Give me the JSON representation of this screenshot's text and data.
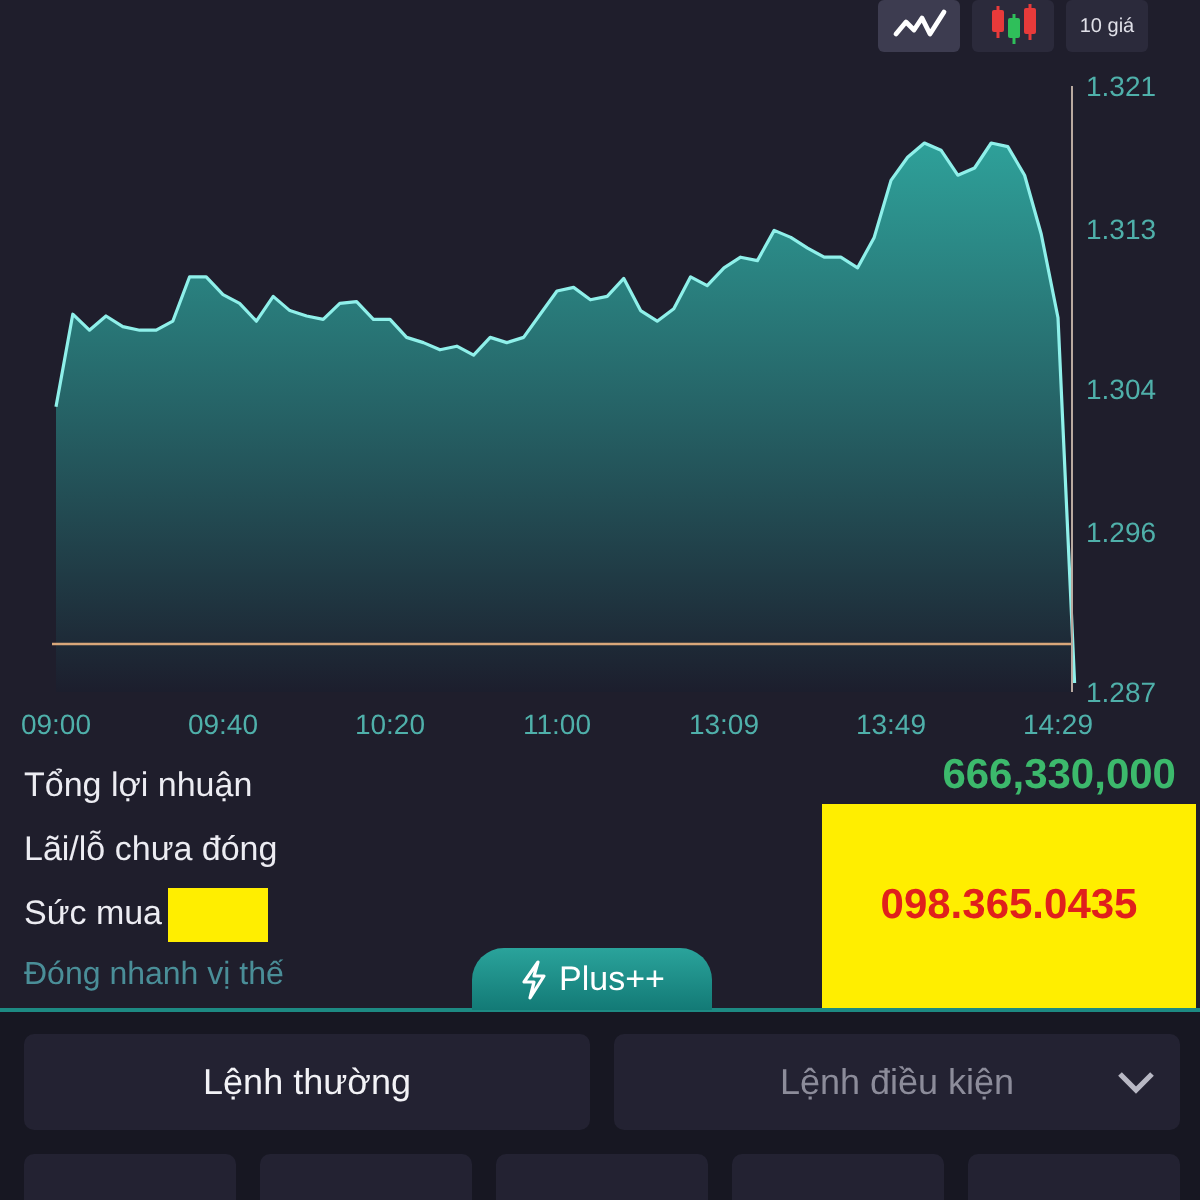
{
  "chart_toolbar": {
    "buttons": [
      {
        "kind": "line",
        "selected": true
      },
      {
        "kind": "candles",
        "selected": false
      },
      {
        "kind": "text",
        "label": "10 giá",
        "selected": false
      }
    ]
  },
  "price_chart": {
    "chart_data": {
      "type": "area",
      "categories": [
        "09:00",
        null,
        null,
        null,
        null,
        null,
        null,
        null,
        null,
        null,
        "09:40",
        null,
        null,
        null,
        null,
        null,
        null,
        null,
        null,
        null,
        "10:20",
        null,
        null,
        null,
        null,
        null,
        null,
        null,
        null,
        null,
        "11:00",
        null,
        null,
        null,
        null,
        null,
        null,
        null,
        null,
        null,
        "13:09",
        null,
        null,
        null,
        null,
        null,
        null,
        null,
        null,
        null,
        "13:49",
        null,
        null,
        null,
        null,
        null,
        null,
        null,
        null,
        null,
        "14:29",
        null
      ],
      "series": [
        {
          "color": "#8ff0ea",
          "values": [
            1.303,
            1.3082,
            1.3073,
            1.3081,
            1.3075,
            1.3073,
            1.3073,
            1.3078,
            1.3103,
            1.3103,
            1.3093,
            1.3088,
            1.3078,
            1.3092,
            1.3084,
            1.3081,
            1.3079,
            1.3088,
            1.3089,
            1.3079,
            1.3079,
            1.3069,
            1.3066,
            1.3062,
            1.3064,
            1.3059,
            1.3069,
            1.3066,
            1.3069,
            1.3082,
            1.3095,
            1.3097,
            1.309,
            1.3092,
            1.3102,
            1.3084,
            1.3078,
            1.3085,
            1.3103,
            1.3098,
            1.3108,
            1.3114,
            1.3112,
            1.3129,
            1.3125,
            1.3119,
            1.3114,
            1.3114,
            1.3108,
            1.3125,
            1.3157,
            1.317,
            1.3178,
            1.3174,
            1.316,
            1.3164,
            1.3178,
            1.3176,
            1.316,
            1.3127,
            1.308,
            1.2875
          ]
        }
      ],
      "ylim": [
        1.287,
        1.321
      ],
      "yticks": [
        {
          "value": 1.321,
          "label": "1.321"
        },
        {
          "value": 1.313,
          "label": "1.313"
        },
        {
          "value": 1.304,
          "label": "1.304"
        },
        {
          "value": 1.296,
          "label": "1.296"
        },
        {
          "value": 1.287,
          "label": "1.287"
        }
      ]
    }
  },
  "summary": {
    "rows": [
      {
        "label": "Tổng lợi nhuận",
        "masked": false
      },
      {
        "label": "Lãi/lỗ chưa đóng",
        "masked": false
      },
      {
        "label": "Sức mua",
        "masked": true
      }
    ],
    "total_profit": "666,330,000",
    "quick_close": "Đóng nhanh vị thế",
    "overlay_text": "098.365.0435",
    "plus_tab": "Plus++"
  },
  "order_tabs": [
    {
      "label": "Lệnh thường",
      "selected": true,
      "dropdown": false
    },
    {
      "label": "Lệnh điều kiện",
      "selected": false,
      "dropdown": true
    }
  ]
}
